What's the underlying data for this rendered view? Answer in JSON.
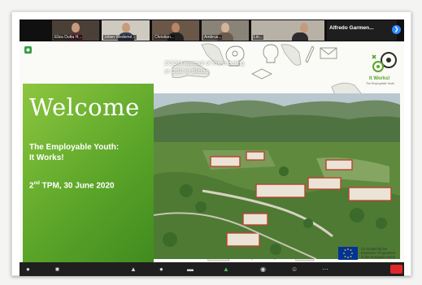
{
  "participants": [
    {
      "name": "Eliza Dutta H..."
    },
    {
      "name": "Jolien Wedemé..."
    },
    {
      "name": "Christian..."
    },
    {
      "name": "Ambrus..."
    },
    {
      "name": "Lin..."
    }
  ],
  "active_speaker": {
    "name": "Alfredo Garmen..."
  },
  "slide": {
    "welcome": "Welcome",
    "subtitle_line1": "The Employable Youth:",
    "subtitle_line2": "It Works!",
    "tpm_number": "2",
    "tpm_suffix": "nd",
    "tpm_rest": " TPM, 30 June 2020",
    "photo_caption_line1": "ZOOM instead of the meeting",
    "photo_caption_line2": "at CSV in Bilbao",
    "logo_line1": "It Works!",
    "logo_line2": "The Employable Youth",
    "eu_line1": "Co-funded by the",
    "eu_line2": "Erasmus+ Programme",
    "eu_line3": "of the European Union"
  },
  "colors": {
    "green_panel": "#5ba529",
    "zoom_blue": "#2d8cff",
    "end_red": "#e02828"
  },
  "toolbar_icons": [
    "microphone-icon",
    "video-icon",
    "security-icon",
    "participants-icon",
    "chat-icon",
    "share-screen-icon",
    "record-icon",
    "reactions-icon",
    "more-icon",
    "end-icon"
  ]
}
